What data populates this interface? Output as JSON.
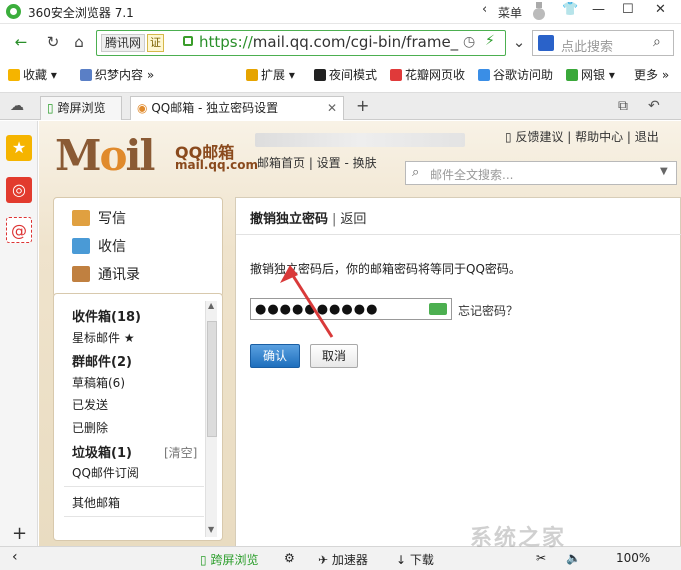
{
  "window": {
    "title": "360安全浏览器 7.1",
    "menu_label": "菜单"
  },
  "navbar": {
    "site_label": "腾讯网",
    "cert_label": "证",
    "url_scheme": "https://",
    "url_rest": "mail.qq.com/cgi-bin/frame_",
    "search_placeholder": "点此搜索"
  },
  "bookmarks": [
    {
      "label": "收藏",
      "icon": "star-icon",
      "color": "#f5b400"
    },
    {
      "label": "织梦内容",
      "icon": "link-icon",
      "color": "#5a7fc6"
    },
    {
      "label": "扩展",
      "icon": "extension-icon",
      "color": "#e6a400"
    },
    {
      "label": "夜间模式",
      "icon": "moon-icon",
      "color": "#222222"
    },
    {
      "label": "花瓣网页收",
      "icon": "petal-icon",
      "color": "#e03a3a"
    },
    {
      "label": "谷歌访问助",
      "icon": "chrome-icon",
      "color": "#3a8ee6"
    },
    {
      "label": "网银",
      "icon": "shield-icon",
      "color": "#3aa83a"
    },
    {
      "label": "更多",
      "icon": "more-icon",
      "color": "#666666"
    }
  ],
  "tabs": [
    {
      "label": "跨屏浏览"
    },
    {
      "label": "QQ邮箱 - 独立密码设置"
    }
  ],
  "mail": {
    "logo_text": "Mail",
    "brand": "QQ邮箱",
    "domain": "mail.qq.com",
    "top_nav": "邮箱首页 | 设置 - 换肤",
    "top_links": "反馈建议 | 帮助中心 | 退出",
    "search_placeholder": "邮件全文搜索..."
  },
  "actions": [
    {
      "label": "写信",
      "icon": "compose-icon",
      "color": "#e0a040"
    },
    {
      "label": "收信",
      "icon": "inbox-icon",
      "color": "#4a9ad6"
    },
    {
      "label": "通讯录",
      "icon": "contacts-icon",
      "color": "#c08040"
    }
  ],
  "folders": [
    {
      "label": "收件箱(18)",
      "bold": true
    },
    {
      "label": "星标邮件 ★",
      "bold": false
    },
    {
      "label": "群邮件(2)",
      "bold": true
    },
    {
      "label": "草稿箱(6)",
      "bold": false
    },
    {
      "label": "已发送",
      "bold": false
    },
    {
      "label": "已删除",
      "bold": false
    },
    {
      "label": "垃圾箱(1)",
      "bold": true
    },
    {
      "label": "QQ邮件订阅",
      "bold": false
    },
    {
      "label": "其他邮箱",
      "bold": false
    }
  ],
  "folder_clear_label": "[清空]",
  "main": {
    "title": "撤销独立密码",
    "back_label": "返回",
    "notice": "撤销独立密码后，你的邮箱密码将等同于QQ密码。",
    "password_value": "●●●●●●●●●●",
    "forgot_label": "忘记密码？",
    "confirm_label": "确认",
    "cancel_label": "取消"
  },
  "statusbar": {
    "cross_screen": "跨屏浏览",
    "accelerator": "加速器",
    "download": "下载",
    "zoom": "100%"
  },
  "watermark": "系统之家"
}
